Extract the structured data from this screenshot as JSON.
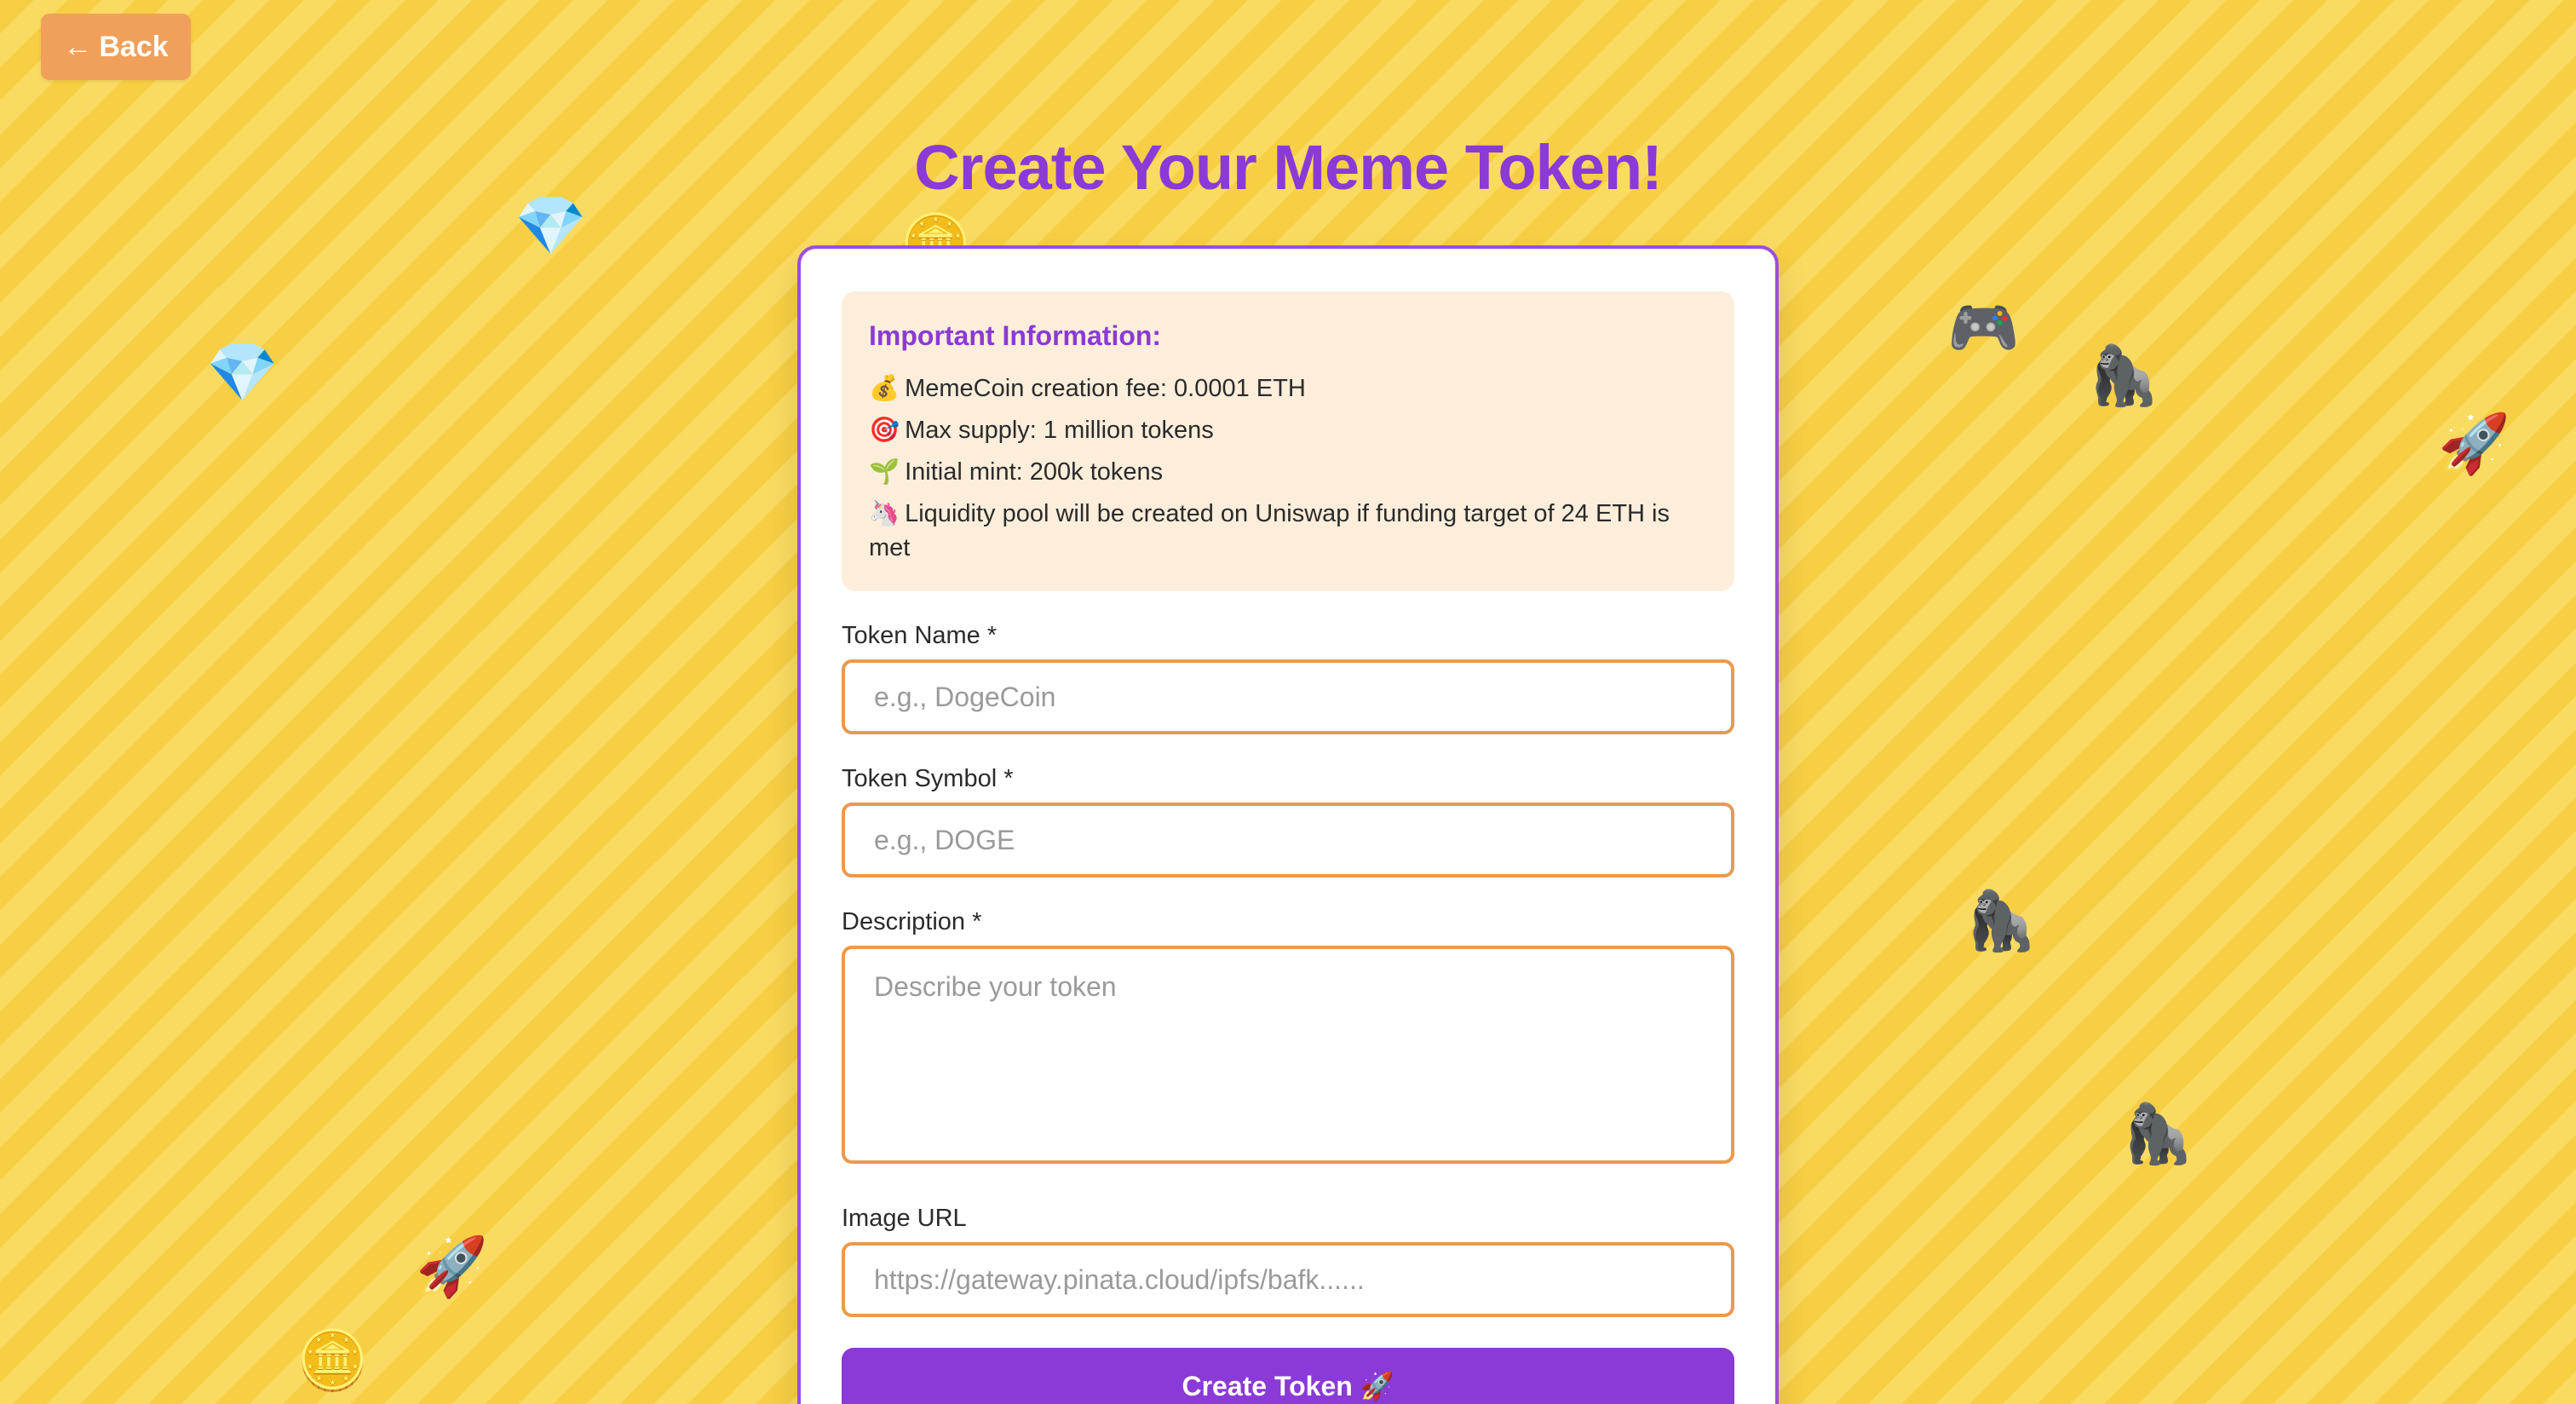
{
  "back_button": {
    "arrow": "←",
    "label": "Back"
  },
  "title": "Create Your Meme Token!",
  "info": {
    "heading": "Important Information:",
    "items": [
      {
        "emoji": "💰",
        "text": "MemeCoin creation fee: 0.0001 ETH"
      },
      {
        "emoji": "🎯",
        "text": "Max supply: 1 million tokens"
      },
      {
        "emoji": "🌱",
        "text": "Initial mint: 200k tokens"
      },
      {
        "emoji": "🦄",
        "text": "Liquidity pool will be created on Uniswap if funding target of 24 ETH is met"
      }
    ]
  },
  "form": {
    "token_name": {
      "label": "Token Name *",
      "placeholder": "e.g., DogeCoin"
    },
    "token_symbol": {
      "label": "Token Symbol *",
      "placeholder": "e.g., DOGE"
    },
    "description": {
      "label": "Description *",
      "placeholder": "Describe your token"
    },
    "image_url": {
      "label": "Image URL",
      "placeholder": "https://gateway.pinata.cloud/ipfs/bafk......"
    },
    "submit_label": "Create Token 🚀"
  },
  "decorations": {
    "diamond": "💎",
    "coin": "🪙",
    "gamepad": "🎮",
    "gorilla": "🦍",
    "rocket": "🚀"
  },
  "colors": {
    "accent_purple": "#8a3ad6",
    "input_border_orange": "#ea9a4d",
    "back_button_orange": "#f0a05a",
    "info_bg": "#fdeedb",
    "background_yellow": "#f8d24e"
  }
}
